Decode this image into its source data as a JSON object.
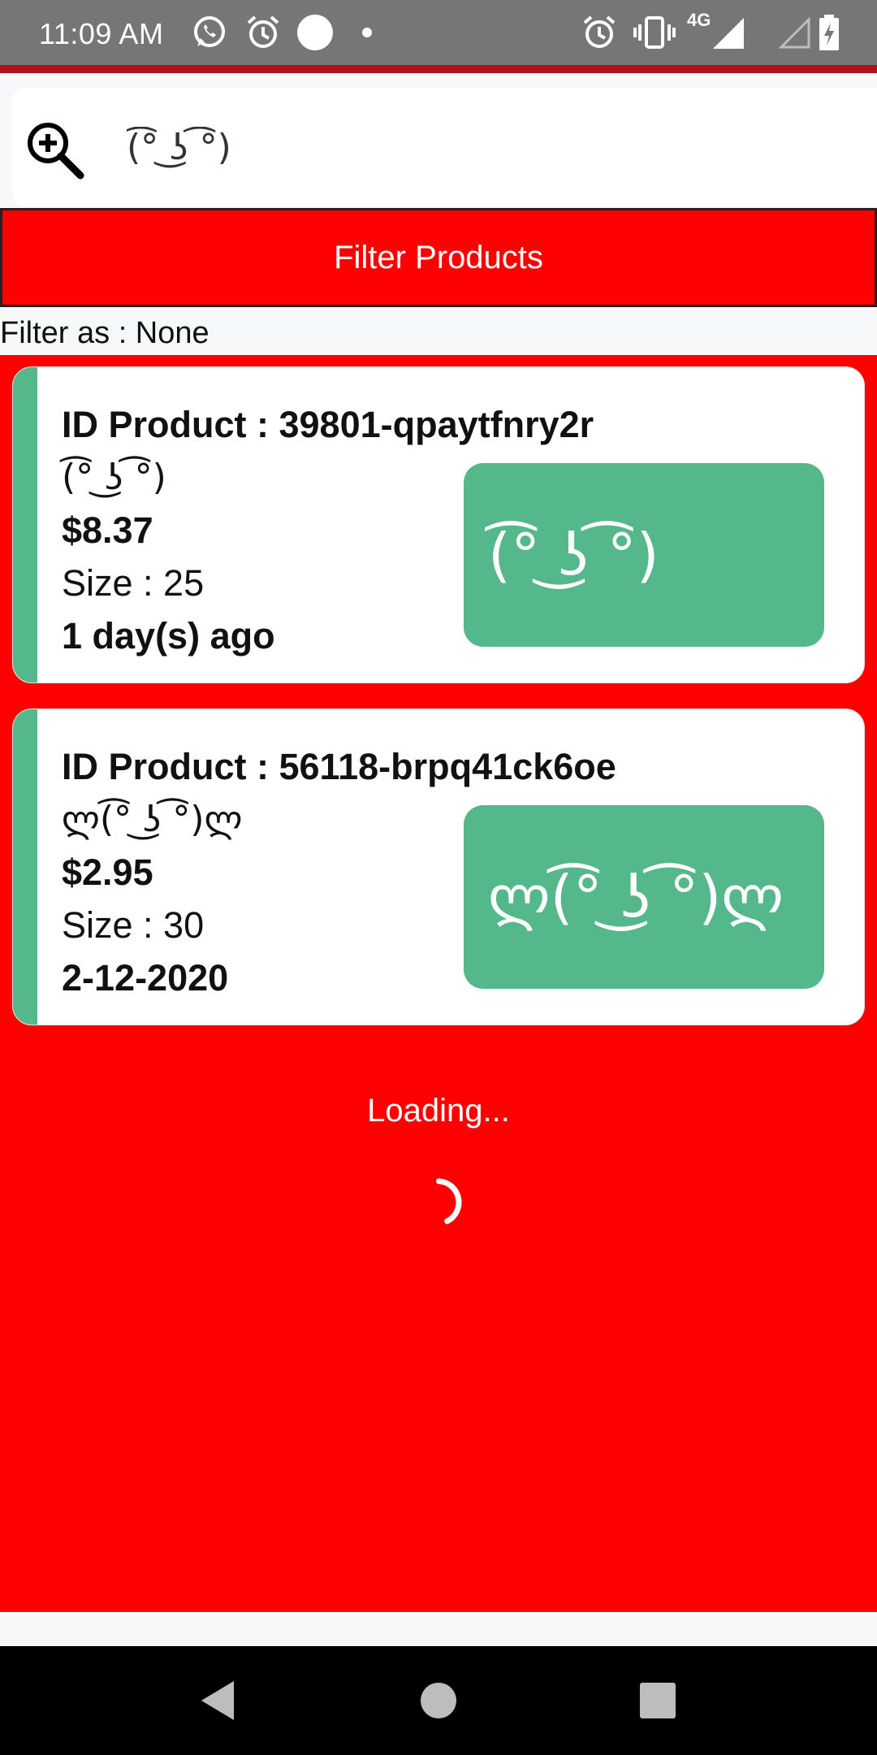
{
  "status_bar": {
    "time": "11:09 AM",
    "network": "4G",
    "icons": [
      "whatsapp-icon",
      "alarm-icon",
      "notification-dot-icon",
      "more-dot-icon",
      "alarm-icon",
      "vibrate-icon",
      "signal-icon",
      "signal-empty-icon",
      "battery-charging-icon"
    ]
  },
  "search": {
    "value": "(͡° ͜ʖ ͡°)",
    "icon": "zoom-in-icon"
  },
  "filter": {
    "button_label": "Filter Products",
    "status": "Filter as : None"
  },
  "products": [
    {
      "id_label": "ID Product : 39801-qpaytfnry2r",
      "name": "(͡° ͜ʖ ͡°)",
      "price": "$8.37",
      "size": "Size : 25",
      "date": "1 day(s) ago",
      "thumb_text": "(͡° ͜ʖ ͡°)"
    },
    {
      "id_label": "ID Product : 56118-brpq41ck6oe",
      "name": "ლ(͡° ͜ʖ ͡°)ლ",
      "price": "$2.95",
      "size": "Size : 30",
      "date": "2-12-2020",
      "thumb_text": "ლ(͡° ͜ʖ ͡°)ლ"
    }
  ],
  "loading": {
    "text": "Loading..."
  },
  "colors": {
    "list_background": "#ff0000",
    "card_accent": "#55b88b",
    "status_bar": "#767676",
    "accent_line": "#b0101a"
  },
  "nav": {
    "buttons": [
      "back-icon",
      "home-icon",
      "recents-icon"
    ]
  }
}
